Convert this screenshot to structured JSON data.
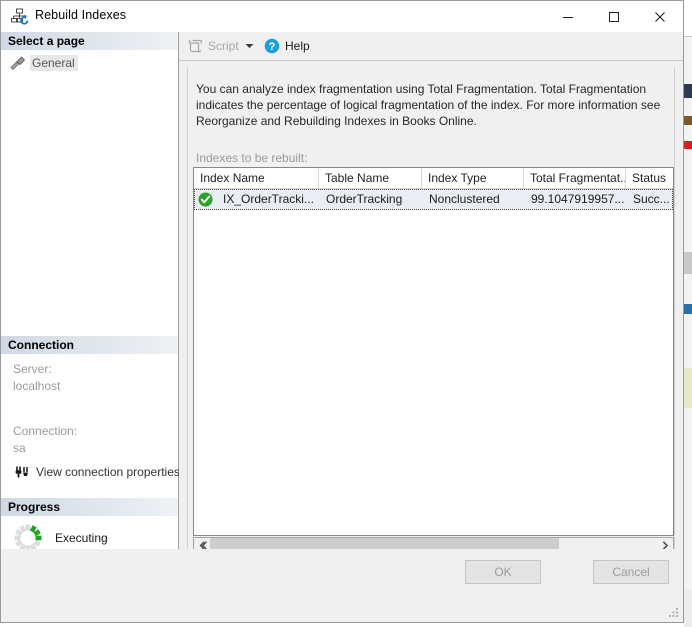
{
  "window": {
    "title": "Rebuild Indexes",
    "icon": "rebuild-indexes-icon",
    "minimize_label": "Minimize",
    "maximize_label": "Maximize",
    "close_label": "Close"
  },
  "sidebar": {
    "select_a_page_header": "Select a page",
    "pages": [
      {
        "label": "General",
        "icon": "page-general-icon",
        "selected": true
      }
    ],
    "connection_header": "Connection",
    "connection": {
      "server_label": "Server:",
      "server_value": "localhost",
      "connection_label": "Connection:",
      "connection_value": "sa",
      "view_properties_label": "View connection properties",
      "view_properties_icon": "connection-properties-icon"
    },
    "progress_header": "Progress",
    "progress": {
      "status": "Executing",
      "spinner_icon": "progress-spinner-icon",
      "spinner_color": "#2aa12a",
      "spinner_track_color": "#dcdcdc"
    }
  },
  "toolbar": {
    "script_label": "Script",
    "script_icon": "script-icon",
    "script_dropdown_icon": "chevron-down-icon",
    "script_enabled": false,
    "help_label": "Help",
    "help_icon": "help-question-icon",
    "help_icon_color": "#1c9fd8"
  },
  "main": {
    "description": "You can analyze index fragmentation using Total Fragmentation. Total Fragmentation indicates the percentage of logical fragmentation of the index. For more information see Reorganize and Rebuilding Indexes in Books Online.",
    "grid_label": "Indexes to be rebuilt:",
    "grid": {
      "columns": [
        "Index Name",
        "Table Name",
        "Index Type",
        "Total Fragmentat...",
        "Status"
      ],
      "rows": [
        {
          "status_icon": "success-check-icon",
          "status_icon_color": "#2aa12a",
          "selected": true,
          "cells": [
            "IX_OrderTracki...",
            "OrderTracking",
            "Nonclustered",
            "99.1047919957...",
            "Succ..."
          ]
        }
      ]
    },
    "scrollbar": {
      "left_arrow_icon": "chevron-left-icon",
      "right_arrow_icon": "chevron-right-icon",
      "thumb_percent": 78
    }
  },
  "footer": {
    "ok_label": "OK",
    "ok_enabled": false,
    "cancel_label": "Cancel",
    "cancel_enabled": false,
    "resize_grip_icon": "resize-grip-icon"
  }
}
